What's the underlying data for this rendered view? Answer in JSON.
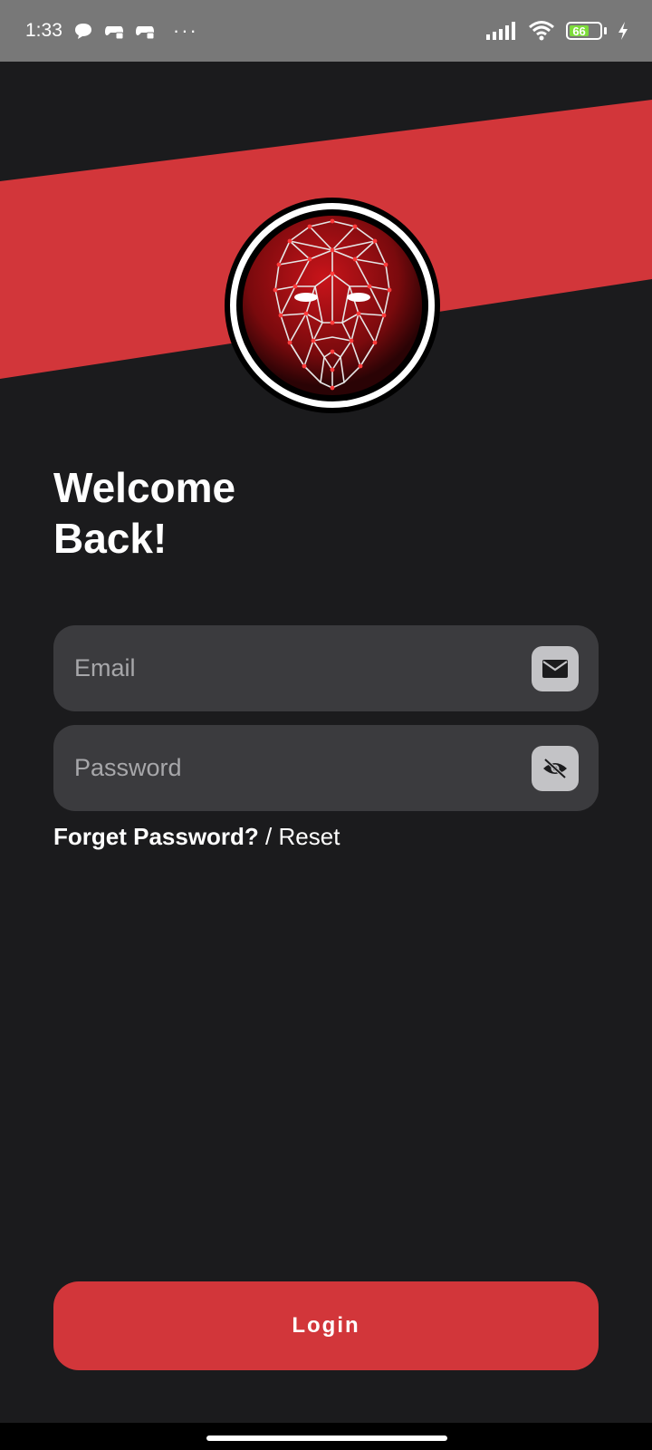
{
  "status_bar": {
    "time": "1:33",
    "overflow": "···",
    "battery_level": "66",
    "icons": [
      "chat-bubble-icon",
      "game-controller-icon",
      "game-controller-icon",
      "signal-icon",
      "wifi-icon",
      "battery-icon",
      "charging-icon"
    ]
  },
  "colors": {
    "background": "#1b1b1d",
    "accent": "#d2363a",
    "field_bg": "#3b3b3e"
  },
  "welcome": {
    "line1": "Welcome",
    "line2": "Back!"
  },
  "form": {
    "email_placeholder": "Email",
    "password_placeholder": "Password",
    "email_icon": "mail-icon",
    "password_icon": "eye-off-icon"
  },
  "forgot": {
    "question": "Forget Password?",
    "separator": " / ",
    "reset": "Reset"
  },
  "login": {
    "label": "Login"
  }
}
